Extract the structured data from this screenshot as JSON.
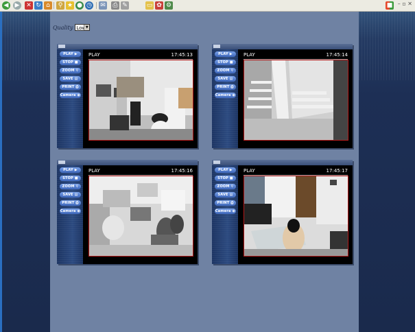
{
  "quality": {
    "label": "Quality",
    "selected": "Low"
  },
  "panels": [
    {
      "status": "PLAY",
      "time": "17:45:13",
      "buttons": [
        "PLAY",
        "STOP",
        "ZOOM",
        "SAVE",
        "PRINT",
        "Camera"
      ]
    },
    {
      "status": "PLAY",
      "time": "17:45:14",
      "buttons": [
        "PLAY",
        "STOP",
        "ZOOM",
        "SAVE",
        "PRINT",
        "Camera"
      ]
    },
    {
      "status": "PLAY",
      "time": "17:45:16",
      "buttons": [
        "PLAY",
        "STOP",
        "ZOOM",
        "SAVE",
        "PRINT",
        "Camera"
      ]
    },
    {
      "status": "PLAY",
      "time": "17:45:17",
      "buttons": [
        "PLAY",
        "STOP",
        "ZOOM",
        "SAVE",
        "PRINT",
        "Camera"
      ]
    }
  ],
  "button_icons": [
    "play-icon",
    "stop-icon",
    "zoom-icon",
    "save-icon",
    "print-icon",
    "camera-icon"
  ],
  "colors": {
    "background": "#1b2a4c",
    "center": "#6f82a3",
    "button": "#5a86d8",
    "video_border": "#b51a1a"
  }
}
